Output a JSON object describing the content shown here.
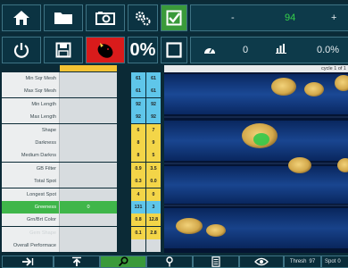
{
  "toolbar_top": {
    "minus_label": "-",
    "counter_value": "94",
    "plus_label": "+"
  },
  "toolbar_second": {
    "percent_big": "0%",
    "speed_value": "0",
    "rate_value": "0.0%"
  },
  "image_panel": {
    "cycle_text": "cycle 1 of 1"
  },
  "settings": [
    {
      "label": "Min Sqr Mesh",
      "mid": "",
      "a": "61",
      "b": "61",
      "color": "blue",
      "state": ""
    },
    {
      "label": "Max Sqr Mesh",
      "mid": "",
      "a": "61",
      "b": "61",
      "color": "blue",
      "state": ""
    },
    {
      "label": "Min Length",
      "mid": "",
      "a": "92",
      "b": "92",
      "color": "blue",
      "state": ""
    },
    {
      "label": "Max Length",
      "mid": "",
      "a": "92",
      "b": "92",
      "color": "blue",
      "state": ""
    },
    {
      "label": "Shape",
      "mid": "",
      "a": "6",
      "b": "7",
      "color": "yellow",
      "state": ""
    },
    {
      "label": "Darkness",
      "mid": "",
      "a": "8",
      "b": "9",
      "color": "yellow",
      "state": ""
    },
    {
      "label": "Medium Darkns",
      "mid": "",
      "a": "8",
      "b": "5",
      "color": "yellow",
      "state": ""
    },
    {
      "label": "GB Filter",
      "mid": "",
      "a": "0.9",
      "b": "3.5",
      "color": "yellow",
      "state": ""
    },
    {
      "label": "Total Spot",
      "mid": "",
      "a": "0.3",
      "b": "0.0",
      "color": "yellow",
      "state": ""
    },
    {
      "label": "Longest Spot",
      "mid": "",
      "a": "4",
      "b": "0",
      "color": "yellow",
      "state": ""
    },
    {
      "label": "Greeness",
      "mid": "0",
      "a": "131",
      "b": "3",
      "color": "blue",
      "state": "green"
    },
    {
      "label": "Grn/Brt Color",
      "mid": "",
      "a": "0.8",
      "b": "12.8",
      "color": "yellow",
      "state": ""
    },
    {
      "label": "Gem Shape",
      "mid": "",
      "a": "0.1",
      "b": "2.8",
      "color": "yellow",
      "state": "faded"
    },
    {
      "label": "Overall Performace",
      "mid": "",
      "a": "",
      "b": "",
      "color": "gray",
      "state": ""
    }
  ],
  "bottom_bar": {
    "thresh_label": "Thresh",
    "thresh_value": "97",
    "spot_label": "Spot",
    "spot_value": "0"
  },
  "colors": {
    "accent_green": "#3a9a3a",
    "stop_red": "#d91b1b",
    "value_blue": "#5fc6ea",
    "value_yellow": "#f3d548",
    "toolbar_bg": "#0a2d3a"
  }
}
